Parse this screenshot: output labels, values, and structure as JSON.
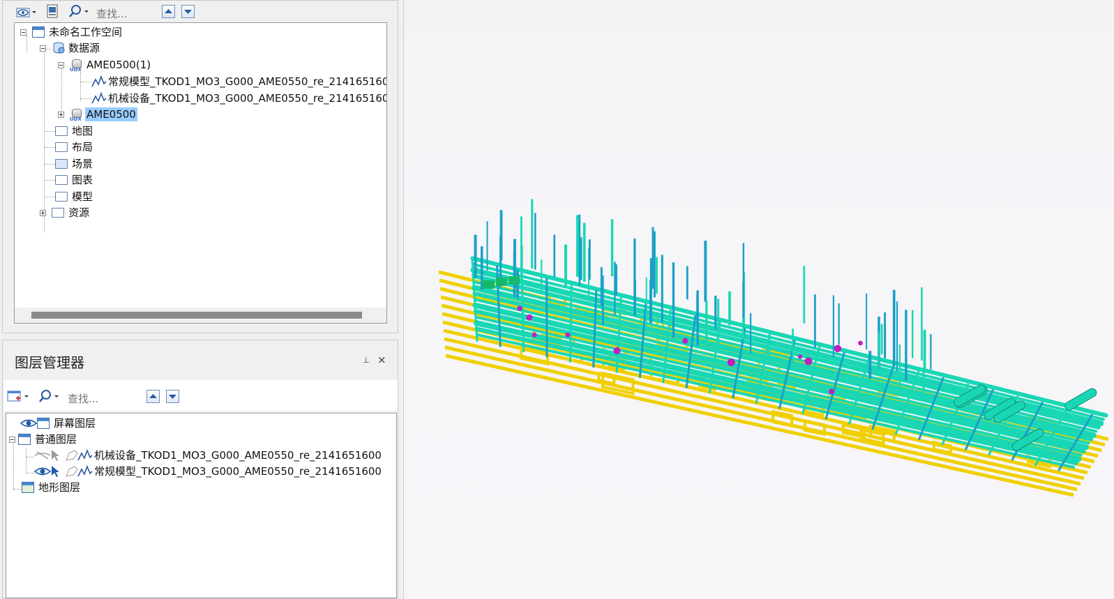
{
  "workspace": {
    "toolbar": {
      "search_placeholder": "查找..."
    },
    "tree": {
      "root": "未命名工作空间",
      "datasource": "数据源",
      "ds1": "AME0500(1)",
      "ds1_child1": "常规模型_TKOD1_MO3_G000_AME0550_re_214165160",
      "ds1_child2": "机械设备_TKOD1_MO3_G000_AME0550_re_214165160",
      "ds2": "AME0500",
      "map": "地图",
      "layout": "布局",
      "scene": "场景",
      "chart": "图表",
      "model": "模型",
      "resource": "资源"
    }
  },
  "layer_manager": {
    "title": "图层管理器",
    "toolbar": {
      "search_placeholder": "查找..."
    },
    "tree": {
      "screen_layer": "屏幕图层",
      "normal_layer": "普通图层",
      "layer1": "机械设备_TKOD1_MO3_G000_AME0550_re_2141651600",
      "layer2": "常规模型_TKOD1_MO3_G000_AME0550_re_2141651600",
      "terrain_layer": "地形图层"
    }
  },
  "scene": {
    "colors": {
      "pipe": "#19d7b4",
      "steel": "#f0d000",
      "accent": "#1aa0c8",
      "magenta": "#c020c0"
    }
  }
}
